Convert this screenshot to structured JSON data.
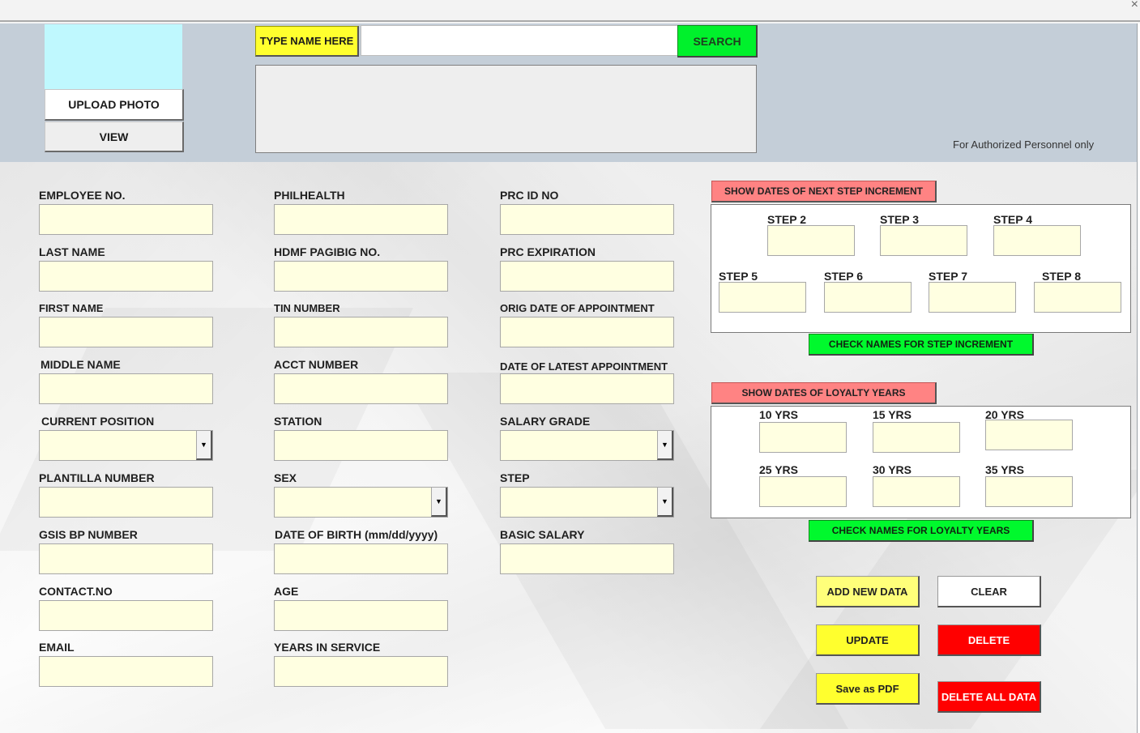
{
  "window": {
    "close_glyph": "×"
  },
  "header": {
    "upload_photo": "UPLOAD PHOTO",
    "view": "VIEW",
    "type_name_label": "TYPE NAME HERE",
    "search_value": "",
    "search_button": "SEARCH",
    "auth_note": "For Authorized Personnel only"
  },
  "form": {
    "col1": {
      "employee_no": "EMPLOYEE NO.",
      "last_name": "LAST NAME",
      "first_name": "FIRST NAME",
      "middle_name": "MIDDLE NAME",
      "current_position": "CURRENT POSITION",
      "plantilla_number": "PLANTILLA NUMBER",
      "gsis_bp_number": "GSIS BP NUMBER",
      "contact_no": "CONTACT.NO",
      "email": "EMAIL"
    },
    "col2": {
      "philhealth": "PHILHEALTH",
      "hdmf": "HDMF PAGIBIG NO.",
      "tin": "TIN NUMBER",
      "acct": "ACCT NUMBER",
      "station": "STATION",
      "sex": "SEX",
      "dob": "DATE OF BIRTH (mm/dd/yyyy)",
      "age": "AGE",
      "years_in_service": "YEARS IN SERVICE"
    },
    "col3": {
      "prc_id": "PRC ID NO",
      "prc_expiration": "PRC EXPIRATION",
      "orig_date": "ORIG DATE OF APPOINTMENT",
      "latest_date": "DATE OF LATEST APPOINTMENT",
      "salary_grade": "SALARY GRADE",
      "step": "STEP",
      "basic_salary": "BASIC SALARY"
    },
    "dropdown_arrow": "▼"
  },
  "steps": {
    "show_button": "SHOW DATES OF NEXT STEP INCREMENT",
    "labels": [
      "STEP 2",
      "STEP 3",
      "STEP 4",
      "STEP 5",
      "STEP 6",
      "STEP 7",
      "STEP 8"
    ],
    "check_button": "CHECK NAMES FOR STEP INCREMENT"
  },
  "loyalty": {
    "show_button": "SHOW DATES OF LOYALTY YEARS",
    "labels": [
      "10 YRS",
      "15 YRS",
      "20 YRS",
      "25 YRS",
      "30 YRS",
      "35 YRS"
    ],
    "check_button": "CHECK NAMES FOR LOYALTY YEARS"
  },
  "actions": {
    "add_new": "ADD NEW DATA",
    "clear": "CLEAR",
    "update": "UPDATE",
    "delete": "DELETE",
    "save_pdf": "Save as PDF",
    "delete_all": "DELETE ALL DATA"
  },
  "colors": {
    "header_band": "#c4ced8",
    "field_fill": "#ffffe1",
    "yellow": "#ffff2e",
    "green": "#00f12c",
    "pink": "#ff8383",
    "red": "#ff0000",
    "photo_fill": "#bff8fe"
  }
}
